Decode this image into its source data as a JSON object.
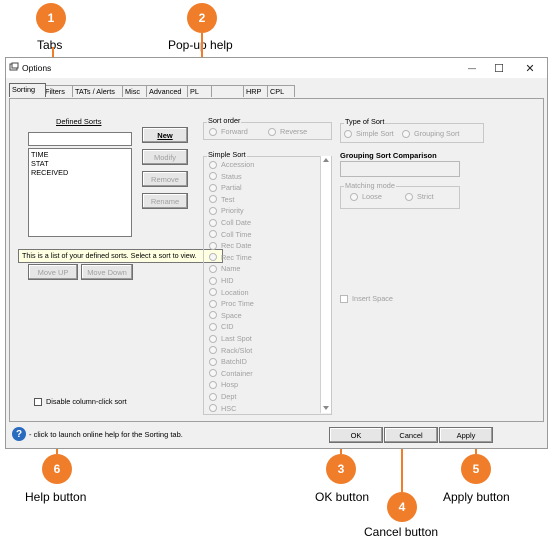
{
  "callouts": [
    {
      "num": "1",
      "label": "Tabs"
    },
    {
      "num": "2",
      "label": "Pop-up help"
    },
    {
      "num": "3",
      "label": "OK button"
    },
    {
      "num": "4",
      "label": "Cancel button"
    },
    {
      "num": "5",
      "label": "Apply button"
    },
    {
      "num": "6",
      "label": "Help button"
    }
  ],
  "window": {
    "title": "Options",
    "minimize": "—",
    "maximize": "☐",
    "close": "✕"
  },
  "tabs": [
    "Sorting",
    "Filters",
    "TATs / Alerts",
    "Misc",
    "Advanced",
    "PL",
    "",
    "HRP",
    "CPL"
  ],
  "defined_sorts": {
    "label": "Defined Sorts",
    "input_value": "",
    "items": [
      "TIME",
      "STAT",
      "RECEIVED"
    ],
    "buttons": {
      "new": "New",
      "modify": "Modify",
      "remove": "Remove",
      "rename": "Rename"
    },
    "move_up": "Move UP",
    "move_down": "Move Down",
    "tooltip": "This is a list of your defined sorts. Select a sort to view."
  },
  "sort_order": {
    "title": "Sort order",
    "options": [
      "Forward",
      "Reverse"
    ]
  },
  "simple_sort": {
    "title": "Simple Sort",
    "items": [
      "Accession",
      "Status",
      "Partial",
      "Test",
      "Priority",
      "Coll Date",
      "Coll Time",
      "Rec Date",
      "Rec Time",
      "Name",
      "HID",
      "Location",
      "Proc Time",
      "Space",
      "CID",
      "Last Spot",
      "Rack/Slot",
      "BatchID",
      "Container",
      "Hosp",
      "Dept",
      "HSC"
    ]
  },
  "type_of_sort": {
    "title": "Type of Sort",
    "options": [
      "Simple Sort",
      "Grouping Sort"
    ]
  },
  "grouping": {
    "title": "Grouping Sort Comparison",
    "matching_title": "Matching mode",
    "options": [
      "Loose",
      "Strict"
    ]
  },
  "insert_space": "Insert Space",
  "disable_column_click": "Disable column-click sort",
  "help_text": "- click to launch online help for the Sorting tab.",
  "buttons": {
    "ok": "OK",
    "cancel": "Cancel",
    "apply": "Apply"
  },
  "colors": {
    "callout": "#f07d2a",
    "help_icon": "#2a6bbf",
    "tooltip_bg": "#ffffe1"
  }
}
